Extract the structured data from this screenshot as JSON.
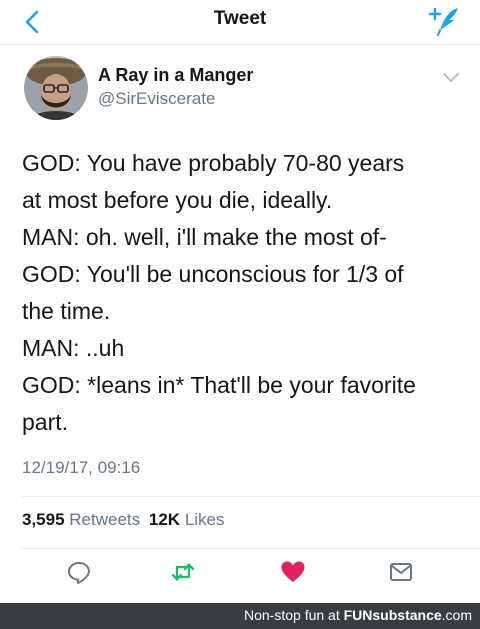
{
  "nav": {
    "title": "Tweet",
    "back_icon": "chevron-left-icon",
    "compose_icon": "compose-tweet-icon",
    "accent": "#1da1f2"
  },
  "author": {
    "display_name": "A Ray in a Manger",
    "handle": "@SirEviscerate",
    "avatar_icon": "user-avatar",
    "menu_icon": "chevron-down-icon"
  },
  "tweet": {
    "lines": [
      "GOD: You have probably 70-80 years",
      "at most before you die, ideally.",
      "MAN: oh. well, i'll make the most of-",
      "GOD: You'll be unconscious for 1/3 of",
      "the time.",
      "MAN: ..uh",
      "GOD: *leans in* That'll be your favorite",
      "part."
    ],
    "timestamp": "12/19/17, 09:16"
  },
  "stats": {
    "retweets_count": "3,595",
    "retweets_label": "Retweets",
    "likes_count": "12K",
    "likes_label": "Likes"
  },
  "actions": {
    "reply_icon": "reply-icon",
    "retweet_icon": "retweet-icon",
    "like_icon": "heart-icon",
    "share_icon": "dm-icon",
    "retweet_color": "#17bf63",
    "like_color": "#e0245e"
  },
  "footer": {
    "text": "Non-stop fun at",
    "brand": "FUNsubstance",
    "suffix": ".com"
  }
}
